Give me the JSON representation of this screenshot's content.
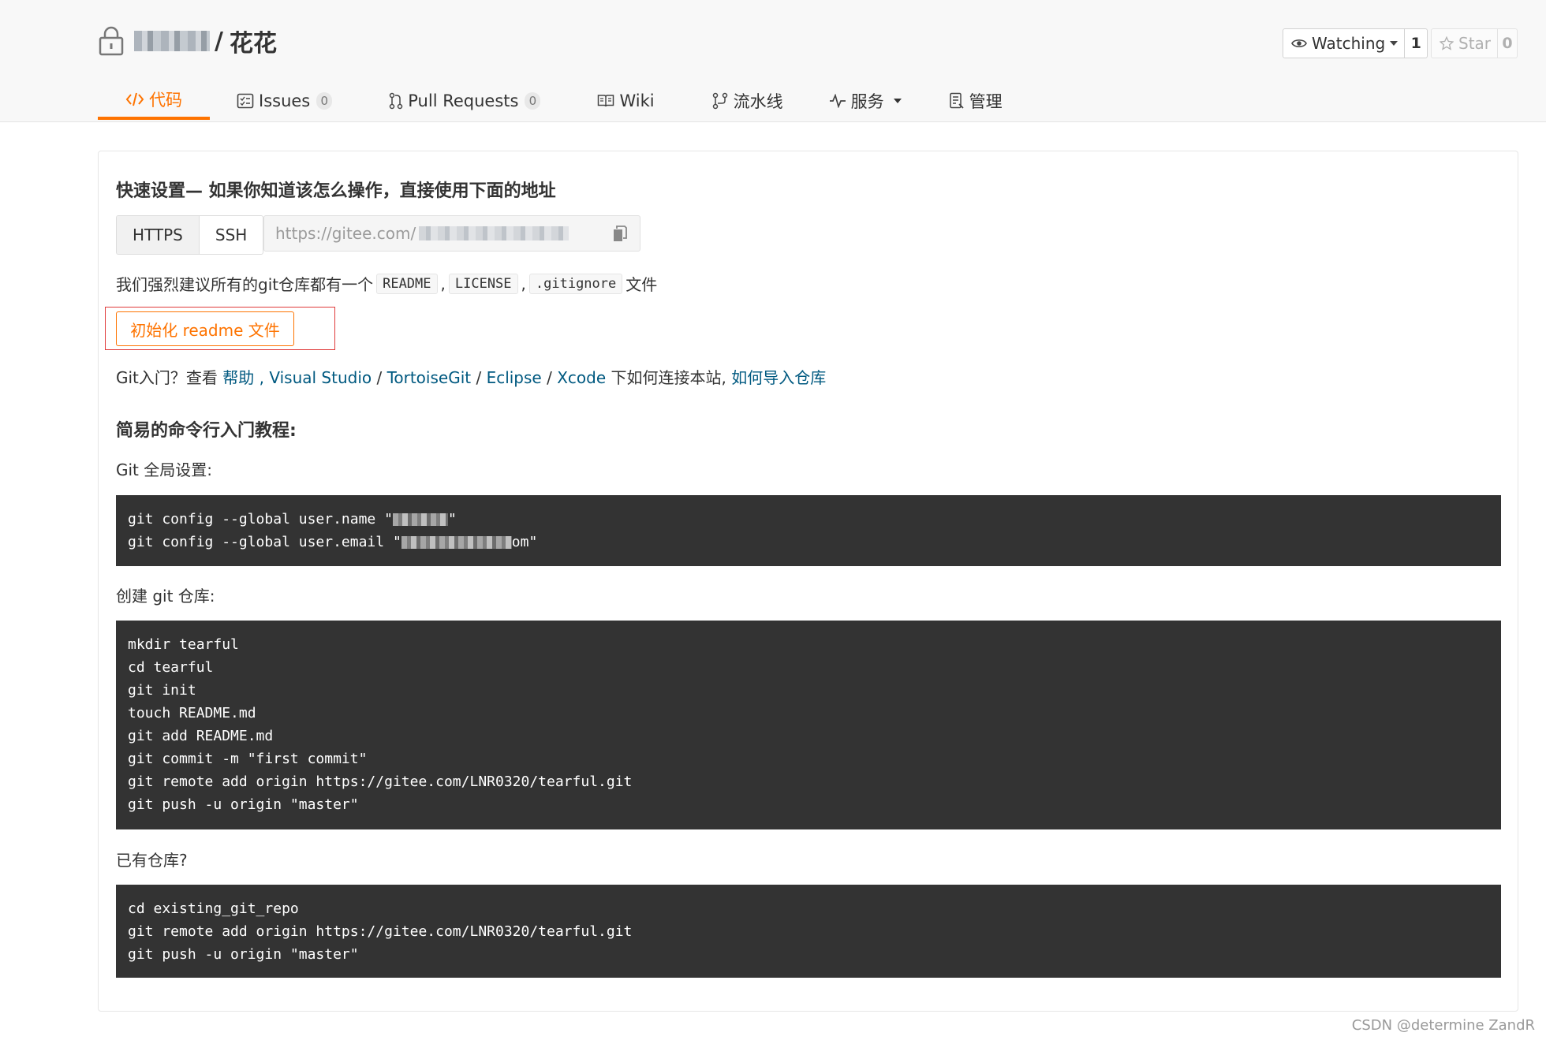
{
  "repo": {
    "separator": "/",
    "name": "花花"
  },
  "watch": {
    "label": "Watching",
    "count": "1"
  },
  "star": {
    "label": "Star",
    "count": "0"
  },
  "tabs": [
    {
      "label": "代码",
      "badge": null
    },
    {
      "label": "Issues",
      "badge": "0"
    },
    {
      "label": "Pull Requests",
      "badge": "0"
    },
    {
      "label": "Wiki",
      "badge": null
    },
    {
      "label": "流水线",
      "badge": null
    },
    {
      "label": "服务",
      "badge": null
    },
    {
      "label": "管理",
      "badge": null
    }
  ],
  "quick": {
    "title": "快速设置— 如果你知道该怎么操作，直接使用下面的地址",
    "https_label": "HTTPS",
    "ssh_label": "SSH",
    "url_prefix": "https://gitee.com/"
  },
  "recommend": {
    "prefix": "我们强烈建议所有的git仓库都有一个",
    "readme": "README",
    "license": "LICENSE",
    "gitignore": ".gitignore",
    "comma": ",",
    "suffix": "文件"
  },
  "init_button": "初始化 readme 文件",
  "help": {
    "prefix": "Git入门？查看 ",
    "link_help": "帮助",
    "sep1": " , ",
    "link_vs": "Visual Studio",
    "slash": " / ",
    "link_tortoise": "TortoiseGit",
    "link_eclipse": "Eclipse",
    "link_xcode": "Xcode",
    "middle": " 下如何连接本站, ",
    "link_import": "如何导入仓库"
  },
  "tutorial": {
    "title": "简易的命令行入门教程:",
    "global_label": "Git 全局设置:",
    "global_lines": [
      "git config --global user.name \"",
      "git config --global user.email \""
    ],
    "global_tail": [
      "\"",
      "om\""
    ],
    "create_label": "创建 git 仓库:",
    "create_lines": [
      "mkdir tearful",
      "cd tearful",
      "git init",
      "touch README.md",
      "git add README.md",
      "git commit -m \"first commit\"",
      "git remote add origin https://gitee.com/LNR0320/tearful.git",
      "git push -u origin \"master\""
    ],
    "existing_label": "已有仓库?",
    "existing_lines": [
      "cd existing_git_repo",
      "git remote add origin https://gitee.com/LNR0320/tearful.git",
      "git push -u origin \"master\""
    ]
  },
  "watermark": "CSDN @determine  ZandR",
  "colors": {
    "accent": "#fe7300",
    "link": "#005980",
    "code_bg": "#333333",
    "highlight": "#e03a3a"
  }
}
